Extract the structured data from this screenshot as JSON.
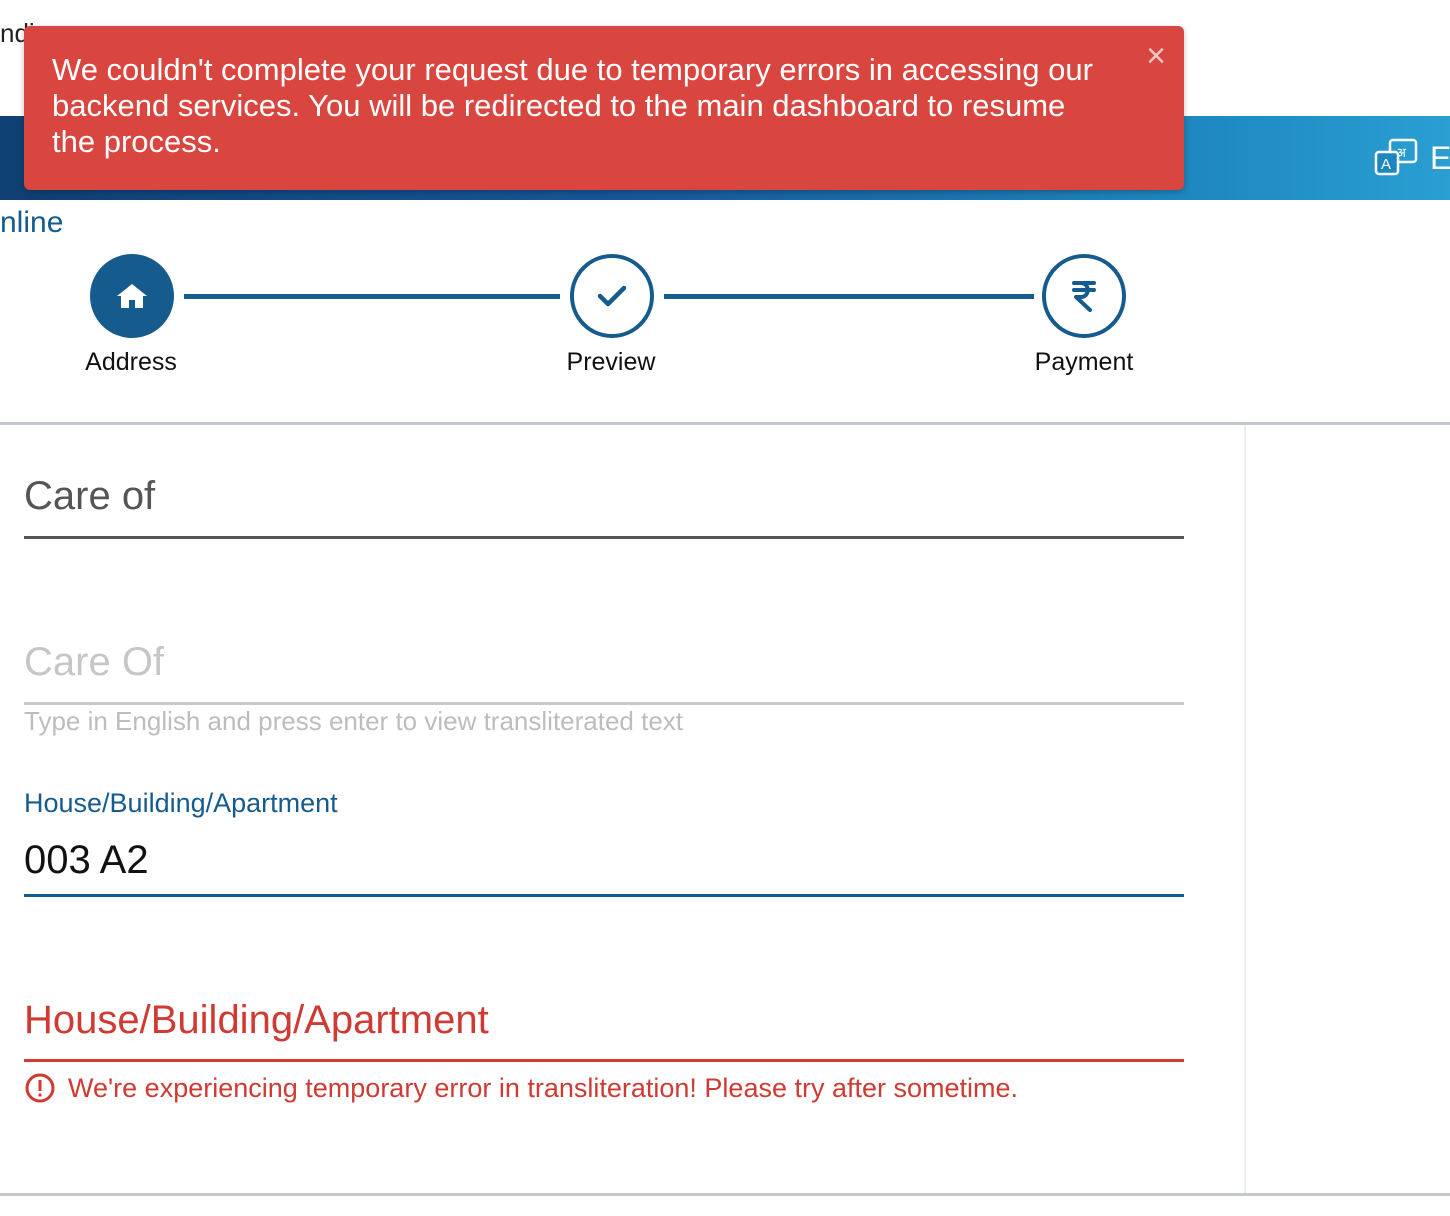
{
  "header": {
    "partial_title": "ndi",
    "language_label": "E",
    "language_icon": "translate-icon"
  },
  "toast": {
    "message": "We couldn't complete your request due to temporary errors in accessing our backend services. You will be redirected to the main dashboard to resume the process.",
    "close_symbol": "×",
    "color": "#d9463f"
  },
  "page": {
    "partial_heading": "nline"
  },
  "stepper": {
    "steps": [
      {
        "label": "Address",
        "icon": "home-icon",
        "state": "active"
      },
      {
        "label": "Preview",
        "icon": "check-icon",
        "state": "pending"
      },
      {
        "label": "Payment",
        "icon": "rupee-icon",
        "state": "pending"
      }
    ],
    "accent": "#155b8e"
  },
  "form": {
    "care_of": {
      "label": "Care of"
    },
    "care_of_local": {
      "placeholder": "Care Of",
      "hint": "Type in English and press enter to view transliterated text"
    },
    "house": {
      "label": "House/Building/Apartment",
      "value": "003 A2"
    },
    "house_local": {
      "label": "House/Building/Apartment",
      "error": "We're experiencing temporary error in transliteration! Please try after sometime.",
      "error_color": "#cf3b32"
    }
  }
}
